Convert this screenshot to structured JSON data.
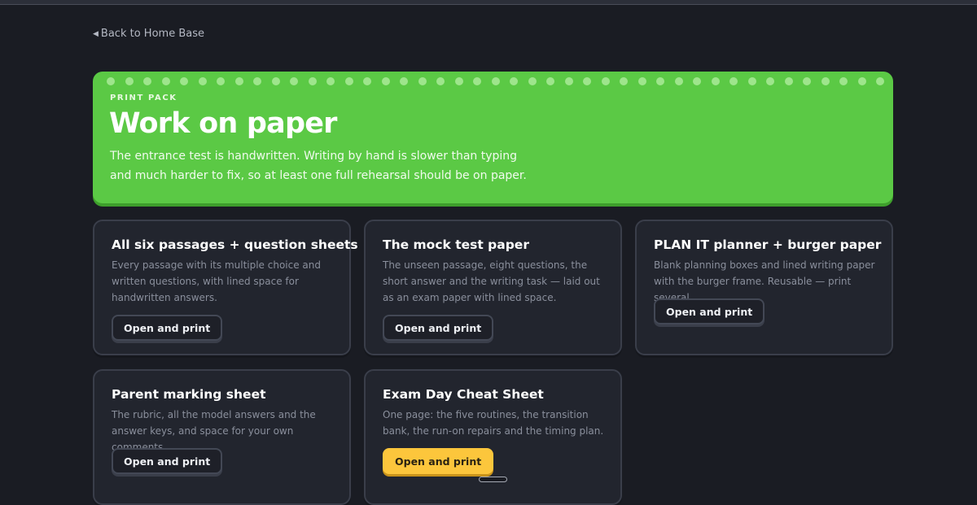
{
  "nav": {
    "back_label": "Back to Home Base"
  },
  "hero": {
    "kicker": "PRINT PACK",
    "title": "Work on paper",
    "description": "The entrance test is handwritten. Writing by hand is slower than typing and much harder to fix, so at least one full rehearsal should be on paper.",
    "color": "#5bc945"
  },
  "cards": [
    {
      "title": "All six passages + question sheets",
      "description": "Every passage with its multiple choice and written questions, with lined space for handwritten answers.",
      "button": "Open and print"
    },
    {
      "title": "The mock test paper",
      "description": "The unseen passage, eight questions, the short answer and the writing task — laid out as an exam paper with lined space.",
      "button": "Open and print"
    },
    {
      "title": "PLAN IT planner + burger paper",
      "description": "Blank planning boxes and lined writing paper with the burger frame. Reusable — print several.",
      "button": "Open and print"
    },
    {
      "title": "Parent marking sheet",
      "description": "The rubric, all the model answers and the answer keys, and space for your own comments.",
      "button": "Open and print"
    },
    {
      "title": "Exam Day Cheat Sheet",
      "description": "One page: the five routines, the transition bank, the run-on repairs and the timing plan.",
      "button": "Open and print",
      "button_color": "#fcc63c"
    }
  ]
}
